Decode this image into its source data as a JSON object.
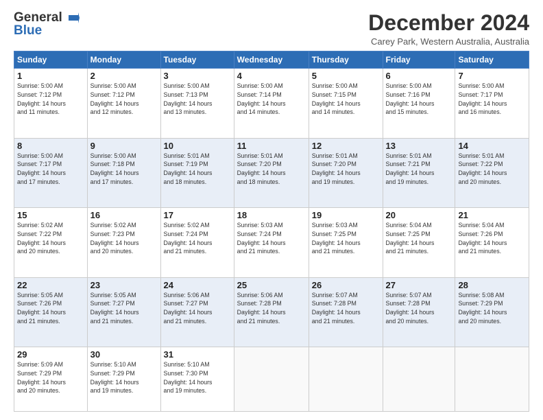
{
  "logo": {
    "line1": "General",
    "line2": "Blue"
  },
  "title": "December 2024",
  "subtitle": "Carey Park, Western Australia, Australia",
  "days_header": [
    "Sunday",
    "Monday",
    "Tuesday",
    "Wednesday",
    "Thursday",
    "Friday",
    "Saturday"
  ],
  "weeks": [
    [
      {
        "num": "1",
        "info": "Sunrise: 5:00 AM\nSunset: 7:12 PM\nDaylight: 14 hours\nand 11 minutes."
      },
      {
        "num": "2",
        "info": "Sunrise: 5:00 AM\nSunset: 7:12 PM\nDaylight: 14 hours\nand 12 minutes."
      },
      {
        "num": "3",
        "info": "Sunrise: 5:00 AM\nSunset: 7:13 PM\nDaylight: 14 hours\nand 13 minutes."
      },
      {
        "num": "4",
        "info": "Sunrise: 5:00 AM\nSunset: 7:14 PM\nDaylight: 14 hours\nand 14 minutes."
      },
      {
        "num": "5",
        "info": "Sunrise: 5:00 AM\nSunset: 7:15 PM\nDaylight: 14 hours\nand 14 minutes."
      },
      {
        "num": "6",
        "info": "Sunrise: 5:00 AM\nSunset: 7:16 PM\nDaylight: 14 hours\nand 15 minutes."
      },
      {
        "num": "7",
        "info": "Sunrise: 5:00 AM\nSunset: 7:17 PM\nDaylight: 14 hours\nand 16 minutes."
      }
    ],
    [
      {
        "num": "8",
        "info": "Sunrise: 5:00 AM\nSunset: 7:17 PM\nDaylight: 14 hours\nand 17 minutes."
      },
      {
        "num": "9",
        "info": "Sunrise: 5:00 AM\nSunset: 7:18 PM\nDaylight: 14 hours\nand 17 minutes."
      },
      {
        "num": "10",
        "info": "Sunrise: 5:01 AM\nSunset: 7:19 PM\nDaylight: 14 hours\nand 18 minutes."
      },
      {
        "num": "11",
        "info": "Sunrise: 5:01 AM\nSunset: 7:20 PM\nDaylight: 14 hours\nand 18 minutes."
      },
      {
        "num": "12",
        "info": "Sunrise: 5:01 AM\nSunset: 7:20 PM\nDaylight: 14 hours\nand 19 minutes."
      },
      {
        "num": "13",
        "info": "Sunrise: 5:01 AM\nSunset: 7:21 PM\nDaylight: 14 hours\nand 19 minutes."
      },
      {
        "num": "14",
        "info": "Sunrise: 5:01 AM\nSunset: 7:22 PM\nDaylight: 14 hours\nand 20 minutes."
      }
    ],
    [
      {
        "num": "15",
        "info": "Sunrise: 5:02 AM\nSunset: 7:22 PM\nDaylight: 14 hours\nand 20 minutes."
      },
      {
        "num": "16",
        "info": "Sunrise: 5:02 AM\nSunset: 7:23 PM\nDaylight: 14 hours\nand 20 minutes."
      },
      {
        "num": "17",
        "info": "Sunrise: 5:02 AM\nSunset: 7:24 PM\nDaylight: 14 hours\nand 21 minutes."
      },
      {
        "num": "18",
        "info": "Sunrise: 5:03 AM\nSunset: 7:24 PM\nDaylight: 14 hours\nand 21 minutes."
      },
      {
        "num": "19",
        "info": "Sunrise: 5:03 AM\nSunset: 7:25 PM\nDaylight: 14 hours\nand 21 minutes."
      },
      {
        "num": "20",
        "info": "Sunrise: 5:04 AM\nSunset: 7:25 PM\nDaylight: 14 hours\nand 21 minutes."
      },
      {
        "num": "21",
        "info": "Sunrise: 5:04 AM\nSunset: 7:26 PM\nDaylight: 14 hours\nand 21 minutes."
      }
    ],
    [
      {
        "num": "22",
        "info": "Sunrise: 5:05 AM\nSunset: 7:26 PM\nDaylight: 14 hours\nand 21 minutes."
      },
      {
        "num": "23",
        "info": "Sunrise: 5:05 AM\nSunset: 7:27 PM\nDaylight: 14 hours\nand 21 minutes."
      },
      {
        "num": "24",
        "info": "Sunrise: 5:06 AM\nSunset: 7:27 PM\nDaylight: 14 hours\nand 21 minutes."
      },
      {
        "num": "25",
        "info": "Sunrise: 5:06 AM\nSunset: 7:28 PM\nDaylight: 14 hours\nand 21 minutes."
      },
      {
        "num": "26",
        "info": "Sunrise: 5:07 AM\nSunset: 7:28 PM\nDaylight: 14 hours\nand 21 minutes."
      },
      {
        "num": "27",
        "info": "Sunrise: 5:07 AM\nSunset: 7:28 PM\nDaylight: 14 hours\nand 20 minutes."
      },
      {
        "num": "28",
        "info": "Sunrise: 5:08 AM\nSunset: 7:29 PM\nDaylight: 14 hours\nand 20 minutes."
      }
    ],
    [
      {
        "num": "29",
        "info": "Sunrise: 5:09 AM\nSunset: 7:29 PM\nDaylight: 14 hours\nand 20 minutes."
      },
      {
        "num": "30",
        "info": "Sunrise: 5:10 AM\nSunset: 7:29 PM\nDaylight: 14 hours\nand 19 minutes."
      },
      {
        "num": "31",
        "info": "Sunrise: 5:10 AM\nSunset: 7:30 PM\nDaylight: 14 hours\nand 19 minutes."
      },
      null,
      null,
      null,
      null
    ]
  ]
}
